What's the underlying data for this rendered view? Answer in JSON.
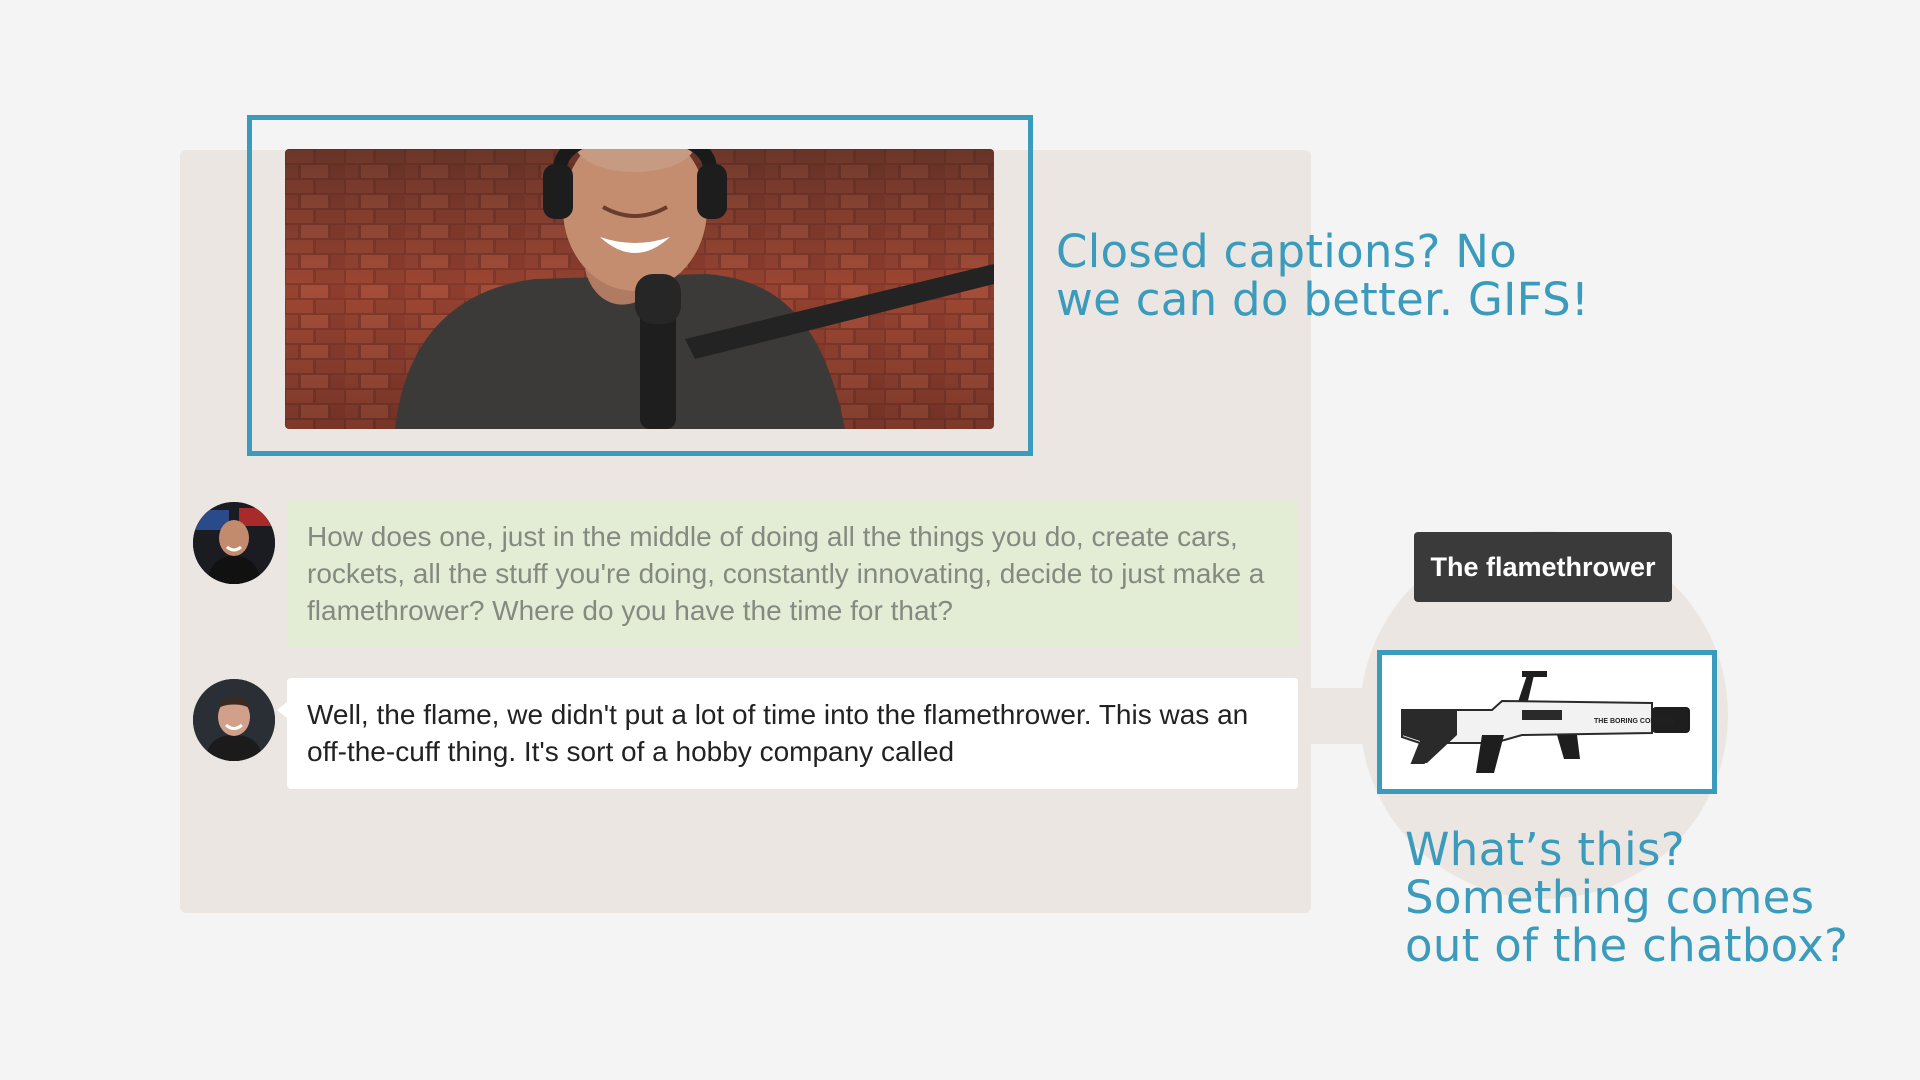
{
  "annotations": {
    "gifs_caption": [
      "Closed captions? No",
      "we can do better. GIFS!"
    ],
    "chatbox_caption": [
      "What’s this?",
      "Something comes",
      "out of the chatbox?"
    ]
  },
  "chat": {
    "messages": [
      {
        "speaker": "host",
        "text": "How does one, just in the middle of doing all the things you do, create cars, rockets, all the stuff you're doing, constantly innovating, decide to just make a flamethrower? Where do you have the time for that?"
      },
      {
        "speaker": "guest",
        "text": "Well, the flame, we didn't put a lot of time into the flamethrower. This was an off-the-cuff thing. It's sort of a hobby company called"
      }
    ]
  },
  "popup": {
    "tooltip": "The flamethrower",
    "product_brand": "THE BORING COMPANY"
  },
  "colors": {
    "accent": "#3a9bbc",
    "panel": "#ebe6e1",
    "host_bubble": "#e3edd5",
    "guest_bubble": "#ffffff",
    "tooltip": "#3a3a3a"
  },
  "icons": {
    "host_avatar": "host-avatar",
    "guest_avatar": "guest-avatar",
    "reaction_gif": "laughing-podcast-host-gif",
    "product": "flamethrower-image"
  }
}
